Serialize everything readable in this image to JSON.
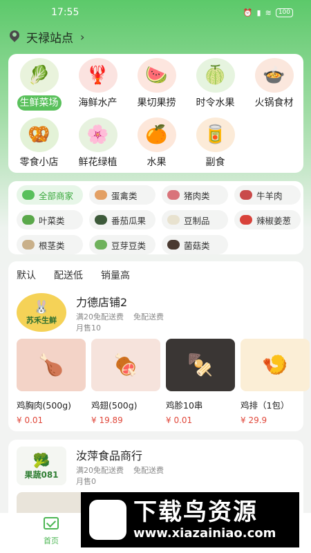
{
  "status": {
    "time": "17:55",
    "battery": "100"
  },
  "location": {
    "name": "天禄站点"
  },
  "categories": [
    {
      "label": "生鲜菜场",
      "icon": "vegetables-icon",
      "active": true
    },
    {
      "label": "海鲜水产",
      "icon": "seafood-icon"
    },
    {
      "label": "果切果捞",
      "icon": "fruit-platter-icon"
    },
    {
      "label": "时令水果",
      "icon": "guava-icon"
    },
    {
      "label": "火锅食材",
      "icon": "hotpot-icon"
    },
    {
      "label": "零食小店",
      "icon": "chips-icon"
    },
    {
      "label": "鲜花绿植",
      "icon": "flower-icon"
    },
    {
      "label": "水果",
      "icon": "orange-icon"
    },
    {
      "label": "副食",
      "icon": "groceries-icon"
    }
  ],
  "filters": [
    {
      "label": "全部商家",
      "active": true
    },
    {
      "label": "蛋禽类"
    },
    {
      "label": "猪肉类"
    },
    {
      "label": "牛羊肉"
    },
    {
      "label": "叶菜类"
    },
    {
      "label": "番茄瓜果"
    },
    {
      "label": "豆制品"
    },
    {
      "label": "辣椒姜葱"
    },
    {
      "label": "根茎类"
    },
    {
      "label": "豆芽豆类"
    },
    {
      "label": "菌菇类"
    }
  ],
  "sort": [
    "默认",
    "配送低",
    "销量高"
  ],
  "stores": [
    {
      "name": "力德店铺2",
      "logo_text": "苏禾生鲜",
      "min_order": "满20免配送费",
      "delivery": "免配送费",
      "sales": "月售10",
      "products": [
        {
          "name": "鸡胸肉(500g)",
          "price": "¥ 0.01"
        },
        {
          "name": "鸡翅(500g)",
          "price": "¥ 19.89"
        },
        {
          "name": "鸡胗10串",
          "price": "¥ 0.01"
        },
        {
          "name": "鸡排（1包）",
          "price": "¥ 29.9"
        }
      ]
    },
    {
      "name": "汝萍食品商行",
      "logo_text": "果蔬081",
      "min_order": "满20免配送费",
      "delivery": "免配送费",
      "sales": "月售0"
    }
  ],
  "tabbar": {
    "home_label": "首页"
  },
  "watermark": {
    "title": "下载鸟资源",
    "url": "www.xiazainiao.com"
  }
}
